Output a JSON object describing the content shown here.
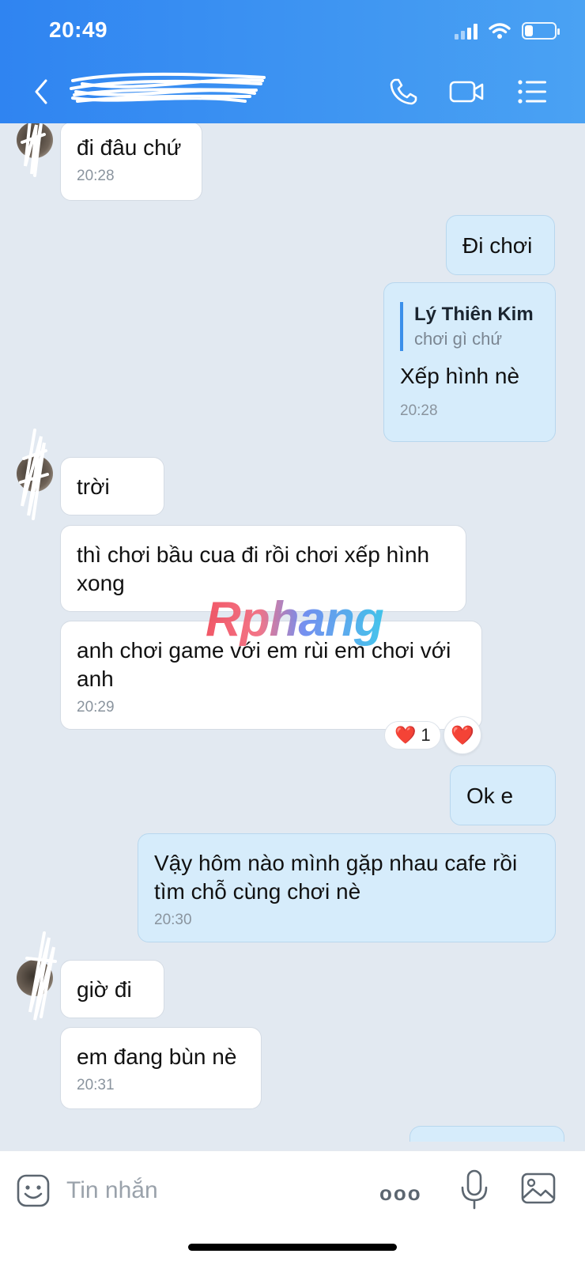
{
  "status_bar": {
    "time": "20:49"
  },
  "header": {
    "contact_name": "Lý Thiên Kim",
    "icons": [
      "back-icon",
      "phone-icon",
      "video-call-icon",
      "menu-list-icon"
    ]
  },
  "messages": [
    {
      "side": "in",
      "text": "đi đâu chứ",
      "time": "20:28"
    },
    {
      "side": "out",
      "text": "Đi chơi"
    },
    {
      "side": "out",
      "quote": {
        "name": "Lý Thiên Kim",
        "text": "chơi gì chứ"
      },
      "text": "Xếp hình nè",
      "time": "20:28"
    },
    {
      "side": "in",
      "text": "trời"
    },
    {
      "side": "in",
      "text": "thì chơi bầu cua đi rồi chơi xếp hình xong"
    },
    {
      "side": "in",
      "text": "anh chơi game với em rùi em chơi với anh",
      "time": "20:29",
      "reaction": {
        "emoji": "❤️",
        "count": "1"
      }
    },
    {
      "side": "out",
      "text": "Ok e"
    },
    {
      "side": "out",
      "text": "Vậy hôm nào mình gặp nhau cafe rồi tìm chỗ cùng chơi nè",
      "time": "20:30"
    },
    {
      "side": "in",
      "text": "giờ đi"
    },
    {
      "side": "in",
      "text": "em đang bùn nè",
      "time": "20:31"
    }
  ],
  "reaction_button": {
    "emoji": "❤️"
  },
  "watermark": "Rphang",
  "input_bar": {
    "placeholder": "Tin nhắn",
    "more_label": "ooo",
    "icons": [
      "sticker-icon",
      "more-icon",
      "microphone-icon",
      "image-icon"
    ]
  },
  "colors": {
    "header": "#2f84f1",
    "background": "#e2e9f1",
    "incoming_bubble": "#ffffff",
    "outgoing_bubble": "#d6ecfb",
    "quote_bar": "#3b8fea"
  }
}
